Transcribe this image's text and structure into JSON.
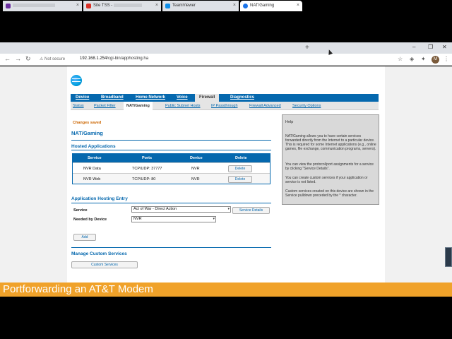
{
  "browser": {
    "tabs": [
      {
        "label": "",
        "icon": "mail-icon",
        "color": "#6b2fa0",
        "active": false
      },
      {
        "label": "Site TSS -",
        "icon": "gmail-icon",
        "color": "#d93025",
        "active": false
      },
      {
        "label": "TeamViewer",
        "icon": "teamviewer-icon",
        "color": "#0e8ee9",
        "active": false
      },
      {
        "label": "NAT/Gaming",
        "icon": "globe-icon",
        "color": "#1a73e8",
        "active": true
      }
    ],
    "new_tab": "+",
    "security": "Not secure",
    "url_host": "192.168.1.254",
    "url_path": "/cgi-bin/apphosting.ha",
    "avatar": "M"
  },
  "nav": {
    "main": [
      "Device",
      "Broadband",
      "Home Network",
      "Voice",
      "Firewall",
      "Diagnostics"
    ],
    "main_active": "Firewall",
    "sub": [
      "Status",
      "Packet Filter",
      "NAT/Gaming",
      "Public Subnet Hosts",
      "IP Passthrough",
      "Firewall Advanced",
      "Security Options"
    ],
    "sub_active": "NAT/Gaming"
  },
  "page": {
    "message": "Changes saved",
    "title": "NAT/Gaming",
    "hosted_title": "Hosted Applications",
    "table": {
      "headers": [
        "Service",
        "Ports",
        "Device",
        "Delete"
      ],
      "rows": [
        {
          "service": "NVR Data",
          "ports": "TCP/UDP: 37777",
          "device": "NVR",
          "action": "Delete"
        },
        {
          "service": "NVR Web",
          "ports": "TCP/UDP: 80",
          "device": "NVR",
          "action": "Delete"
        }
      ]
    },
    "entry_title": "Application Hosting Entry",
    "service_label": "Service",
    "service_value": "Act of War - Direct Action",
    "service_details": "Service Details",
    "needed_label": "Needed by Device",
    "needed_value": "NVR",
    "add_label": "Add",
    "custom_title": "Manage Custom Services",
    "custom_button": "Custom Services"
  },
  "help": {
    "title": "Help",
    "p1": "NAT/Gaming allows you to have certain services forwarded directly from the Internet to a particular device. This is required for some Internet applications (e.g., online games, file exchange, communication programs, servers).",
    "p2": "You can view the protocol/port assignments for a service by clicking \"Service Details\".",
    "p3": "You can create custom services if your application or service is not listed.",
    "p4": "Custom services created on this device are shown in the Service pulldown preceded by the * character."
  },
  "banner": "Portforwarding an AT&T Modem",
  "colors": {
    "att_blue": "#0568ae",
    "banner": "#f0a22a",
    "saved": "#cc6600"
  }
}
